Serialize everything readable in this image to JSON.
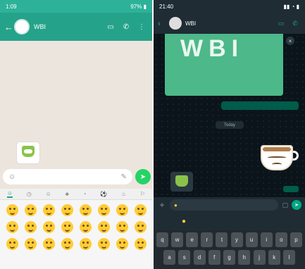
{
  "left": {
    "status": {
      "time": "1:09",
      "right": "97% ▮"
    },
    "header": {
      "back": "←",
      "contact": "WBI",
      "icons": [
        "video-icon",
        "call-icon",
        "menu-icon"
      ],
      "video": "▭",
      "call": "✆",
      "menu": "⋮"
    },
    "input": {
      "emoji": "☺",
      "placeholder": "",
      "attach": "✎"
    },
    "send": "➤",
    "emoji_tabs": [
      "☺",
      "◷",
      "☺",
      "♣",
      "◔",
      "⚽",
      "♨",
      "⚐"
    ],
    "emoji_count": 24
  },
  "right": {
    "status": {
      "time": "21:40",
      "right": "▮▮ ◔ ▮"
    },
    "header": {
      "back": "‹",
      "contact": "WBI",
      "video": "▭",
      "call": "✆"
    },
    "image_text": "WBI",
    "close": "×",
    "outgoing_text": "",
    "day_label": "Today",
    "message_time": "",
    "input": {
      "plus": "+",
      "emoji": "●",
      "placeholder": "",
      "sticker": "▢",
      "send": "➤"
    },
    "suggestion": "●",
    "keyboard_row1": [
      "q",
      "w",
      "e",
      "r",
      "t",
      "y",
      "u",
      "i",
      "o",
      "p"
    ],
    "keyboard_row2": [
      "a",
      "s",
      "d",
      "f",
      "g",
      "h",
      "j",
      "k",
      "l"
    ]
  }
}
